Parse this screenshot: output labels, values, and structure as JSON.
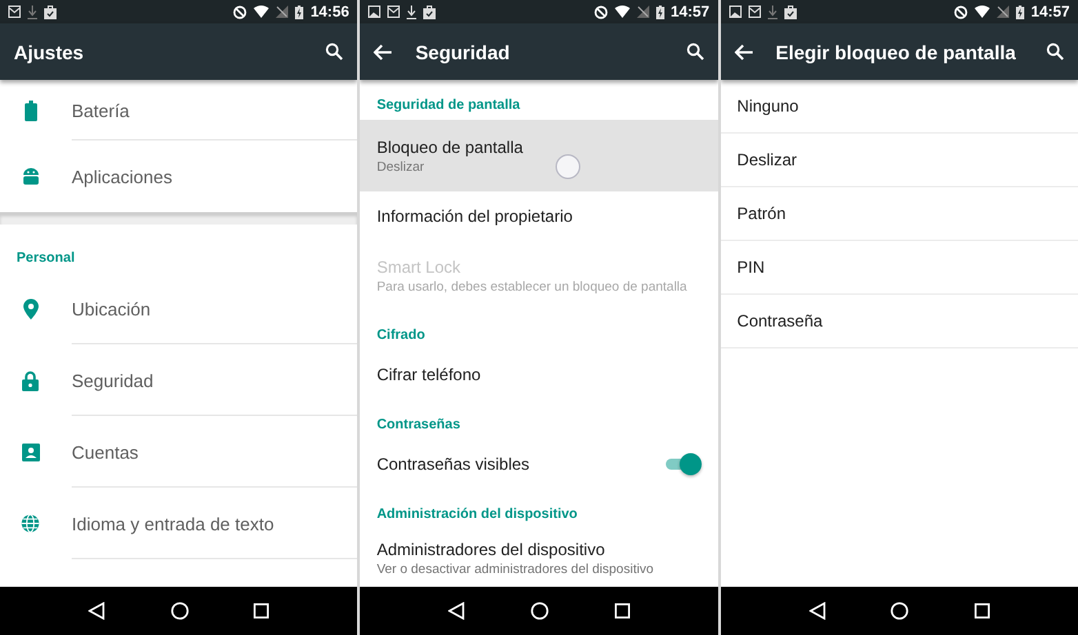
{
  "screens": [
    {
      "time": "14:56",
      "title": "Ajustes",
      "back": false,
      "items": [
        {
          "kind": "icon_item",
          "title": "Batería",
          "divider": true
        },
        {
          "kind": "icon_item",
          "title": "Aplicaciones",
          "divider": false
        },
        {
          "kind": "break"
        },
        {
          "kind": "header",
          "title": "Personal"
        },
        {
          "kind": "icon_item",
          "title": "Ubicación",
          "divider": true
        },
        {
          "kind": "icon_item",
          "title": "Seguridad",
          "divider": true
        },
        {
          "kind": "icon_item",
          "title": "Cuentas",
          "divider": true
        },
        {
          "kind": "icon_item",
          "title": "Idioma y entrada de texto",
          "divider": true
        }
      ]
    },
    {
      "time": "14:57",
      "title": "Seguridad",
      "back": true,
      "items": [
        {
          "kind": "header",
          "title": "Seguridad de pantalla"
        },
        {
          "kind": "item",
          "title": "Bloqueo de pantalla",
          "subtitle": "Deslizar",
          "pressed": true,
          "disabled": false
        },
        {
          "kind": "item",
          "title": "Información del propietario",
          "pressed": false,
          "disabled": false
        },
        {
          "kind": "item",
          "title": "Smart Lock",
          "subtitle": "Para usarlo, debes establecer un bloqueo de pantalla",
          "pressed": false,
          "disabled": true
        },
        {
          "kind": "header",
          "title": "Cifrado"
        },
        {
          "kind": "item",
          "title": "Cifrar teléfono",
          "pressed": false,
          "disabled": false
        },
        {
          "kind": "header",
          "title": "Contraseñas"
        },
        {
          "kind": "switch_item",
          "title": "Contraseñas visibles",
          "on": true
        },
        {
          "kind": "header",
          "title": "Administración del dispositivo"
        },
        {
          "kind": "item",
          "title": "Administradores del dispositivo",
          "subtitle": "Ver o desactivar administradores del dispositivo",
          "pressed": false,
          "disabled": false
        }
      ]
    },
    {
      "time": "14:57",
      "title": "Elegir bloqueo de pantalla",
      "back": true,
      "items": [
        {
          "kind": "option",
          "title": "Ninguno"
        },
        {
          "kind": "option",
          "title": "Deslizar"
        },
        {
          "kind": "option",
          "title": "Patrón"
        },
        {
          "kind": "option",
          "title": "PIN"
        },
        {
          "kind": "option",
          "title": "Contraseña"
        }
      ]
    }
  ]
}
